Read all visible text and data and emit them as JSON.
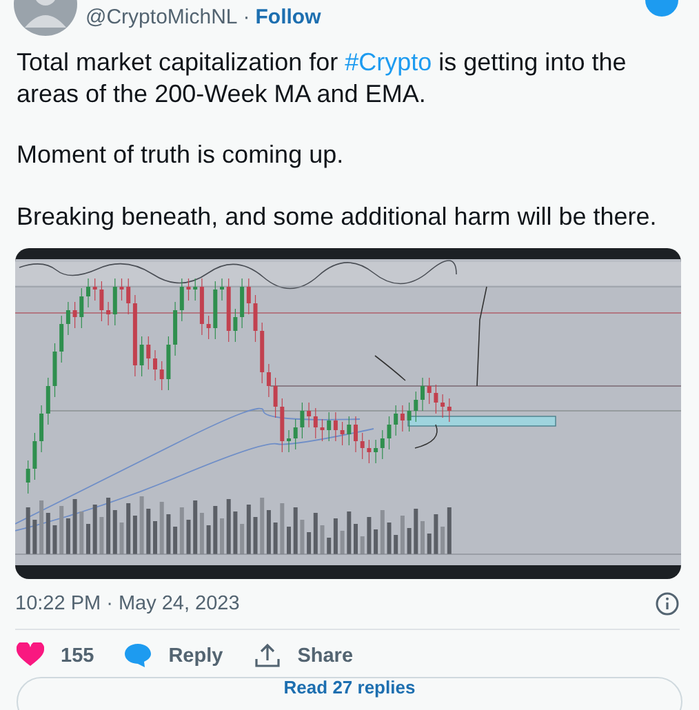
{
  "author": {
    "handle": "@CryptoMichNL",
    "separator": "·",
    "follow": "Follow"
  },
  "paragraphs": [
    {
      "segments": [
        {
          "kind": "text",
          "text": "Total market capitalization for "
        },
        {
          "kind": "hashtag",
          "text": "#Crypto"
        },
        {
          "kind": "text",
          "text": " is getting into the areas of the 200-Week MA and EMA."
        }
      ]
    },
    {
      "segments": [
        {
          "kind": "text",
          "text": "Moment of truth is coming up."
        }
      ]
    },
    {
      "segments": [
        {
          "kind": "text",
          "text": "Breaking beneath, and some additional harm will be there."
        }
      ]
    }
  ],
  "timestamp": "10:22 PM · May 24, 2023",
  "actions": [
    {
      "kind": "like",
      "label": "155"
    },
    {
      "kind": "reply",
      "label": "Reply"
    },
    {
      "kind": "share",
      "label": "Share"
    }
  ],
  "read_replies": "Read 27 replies"
}
